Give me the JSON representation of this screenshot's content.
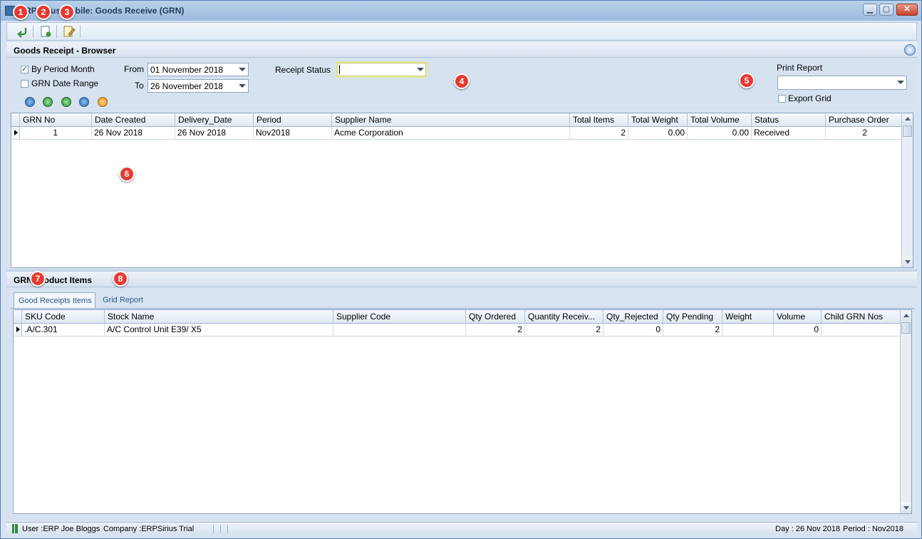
{
  "window": {
    "title": "ERPSirius Mobile: Goods Receive (GRN)",
    "minimize": "▁",
    "maximize": "▢",
    "close": "✕"
  },
  "toolbar": {
    "back_icon": "back-arrow-icon",
    "new_icon": "new-document-icon",
    "edit_icon": "edit-document-icon"
  },
  "browser": {
    "title": "Goods Receipt - Browser",
    "by_period_month": {
      "label": "By Period Month",
      "checked": true
    },
    "grn_date_range": {
      "label": "GRN Date Range",
      "checked": false
    },
    "from_label": "From",
    "from_value": "01 November 2018",
    "to_label": "To",
    "to_value": "26 November 2018",
    "receipt_status_label": "Receipt Status",
    "receipt_status_value": "",
    "print_report_label": "Print Report",
    "print_report_value": "",
    "export_grid_label": "Export Grid",
    "nav_icons": [
      "first-record-icon",
      "previous-record-icon",
      "next-record-icon",
      "last-record-icon",
      "refresh-icon"
    ]
  },
  "grn_grid": {
    "columns": [
      "GRN No",
      "Date Created",
      "Delivery_Date",
      "Period",
      "Supplier Name",
      "Total Items",
      "Total Weight",
      "Total Volume",
      "Status",
      "Purchase Order"
    ],
    "rows": [
      [
        "1",
        "26 Nov 2018",
        "26 Nov 2018",
        "Nov2018",
        "Acme Corporation",
        "2",
        "0.00",
        "0.00",
        "Received",
        "2"
      ]
    ]
  },
  "items": {
    "title": "GRN Product Items",
    "tabs": [
      "Good Receipts Items",
      "Grid Report"
    ],
    "columns": [
      "SKU Code",
      "Stock Name",
      "Supplier Code",
      "Qty Ordered",
      "Quantity Receiv...",
      "Qty_Rejected",
      "Qty Pending",
      "Weight",
      "Volume",
      "Child GRN Nos"
    ],
    "rows": [
      [
        ".A/C.301",
        "A/C Control Unit E39/ X5",
        "",
        "2",
        "2",
        "0",
        "2",
        "",
        "0",
        ""
      ]
    ]
  },
  "status": {
    "user": "User :ERP Joe Bloggs",
    "company": "Company :ERPSirius Trial",
    "day": "Day : 26 Nov 2018",
    "period": "Period : Nov2018"
  },
  "badges": [
    "1",
    "2",
    "3",
    "4",
    "5",
    "6",
    "7",
    "8"
  ],
  "colors": {
    "accent": "#e53b32",
    "frame": "#4f7fb5",
    "panel": "#d6e2ef"
  }
}
